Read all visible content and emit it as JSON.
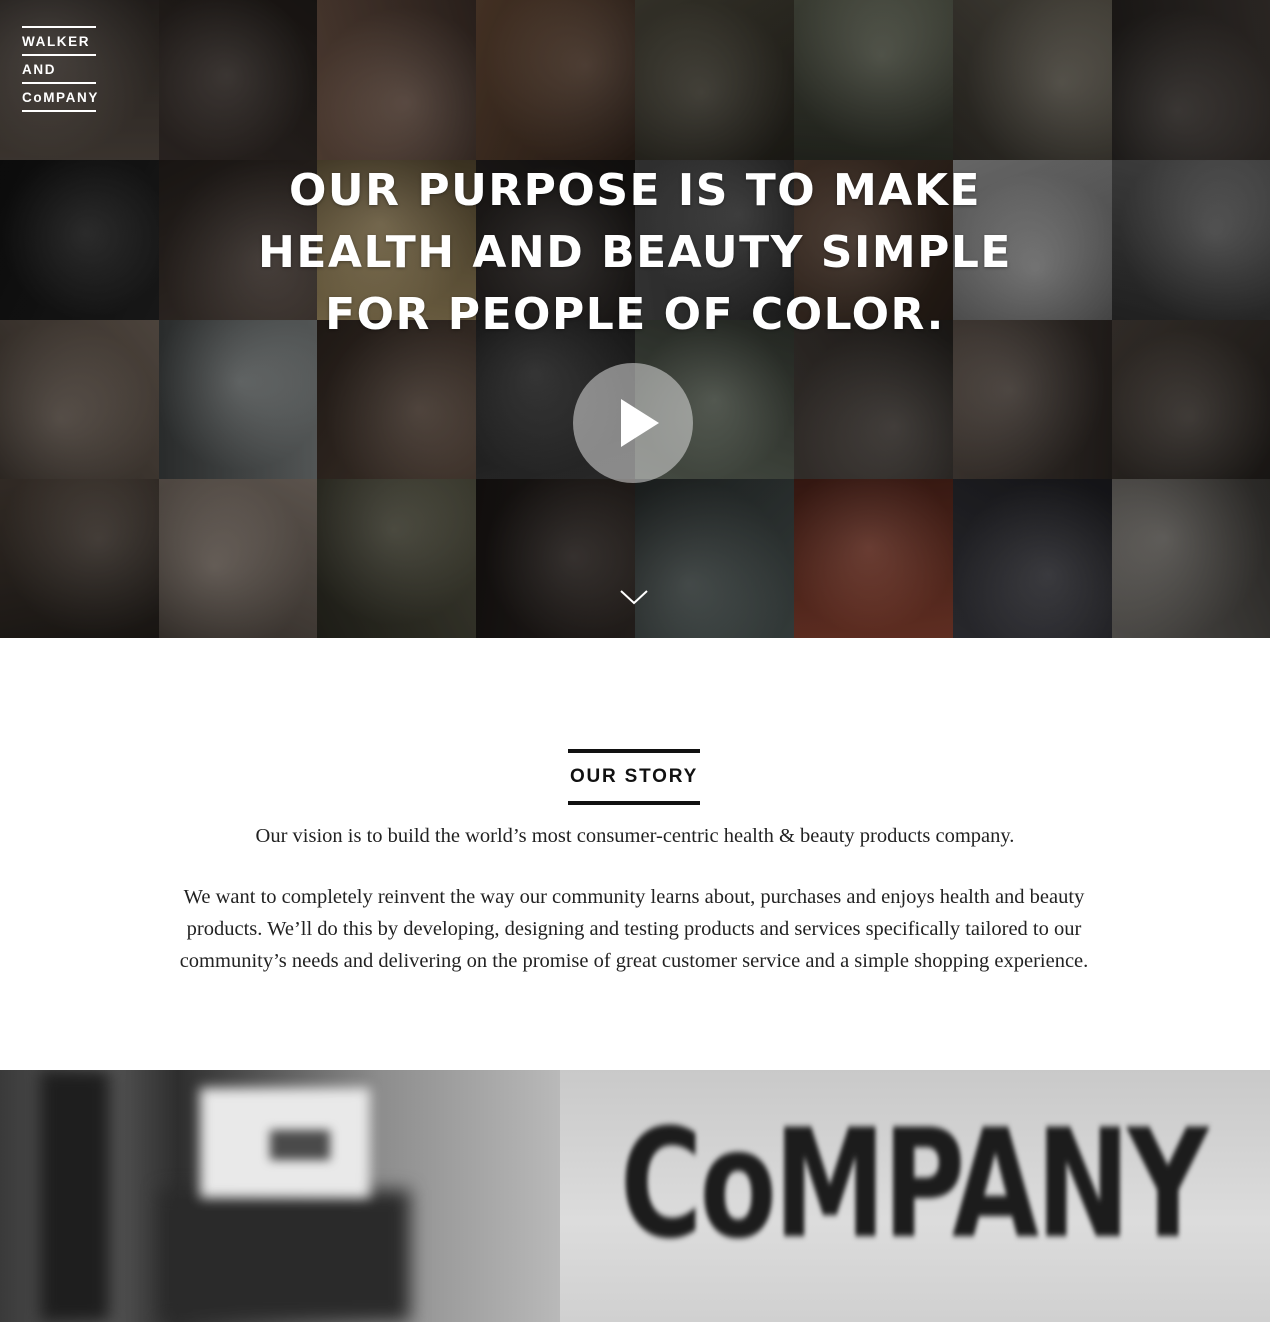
{
  "logo": {
    "line1": "WALKER",
    "line2": "AND",
    "line3": "CoMPANY"
  },
  "hero": {
    "headline_lines": [
      "OUR PURPOSE IS TO MAKE",
      "HEALTH AND BEAUTY SIMPLE",
      "FOR PEOPLE OF COLOR."
    ],
    "play_icon": "play-icon",
    "scroll_icon": "chevron-down-icon"
  },
  "story": {
    "title": "OUR STORY",
    "vision": "Our vision is to build the world’s most consumer-centric health & beauty products company.",
    "body": "We want to completely reinvent the way our community learns about, purchases and enjoys health and beauty products. We’ll do this by developing, designing and testing products and services specifically tailored to our community’s needs and delivering on the promise of great customer service and a simple shopping experience."
  },
  "bottom_photo": {
    "sign_text": "CoMPANY"
  },
  "colors": {
    "text_dark": "#111111",
    "body_text": "#222222",
    "hero_text": "#ffffff"
  }
}
